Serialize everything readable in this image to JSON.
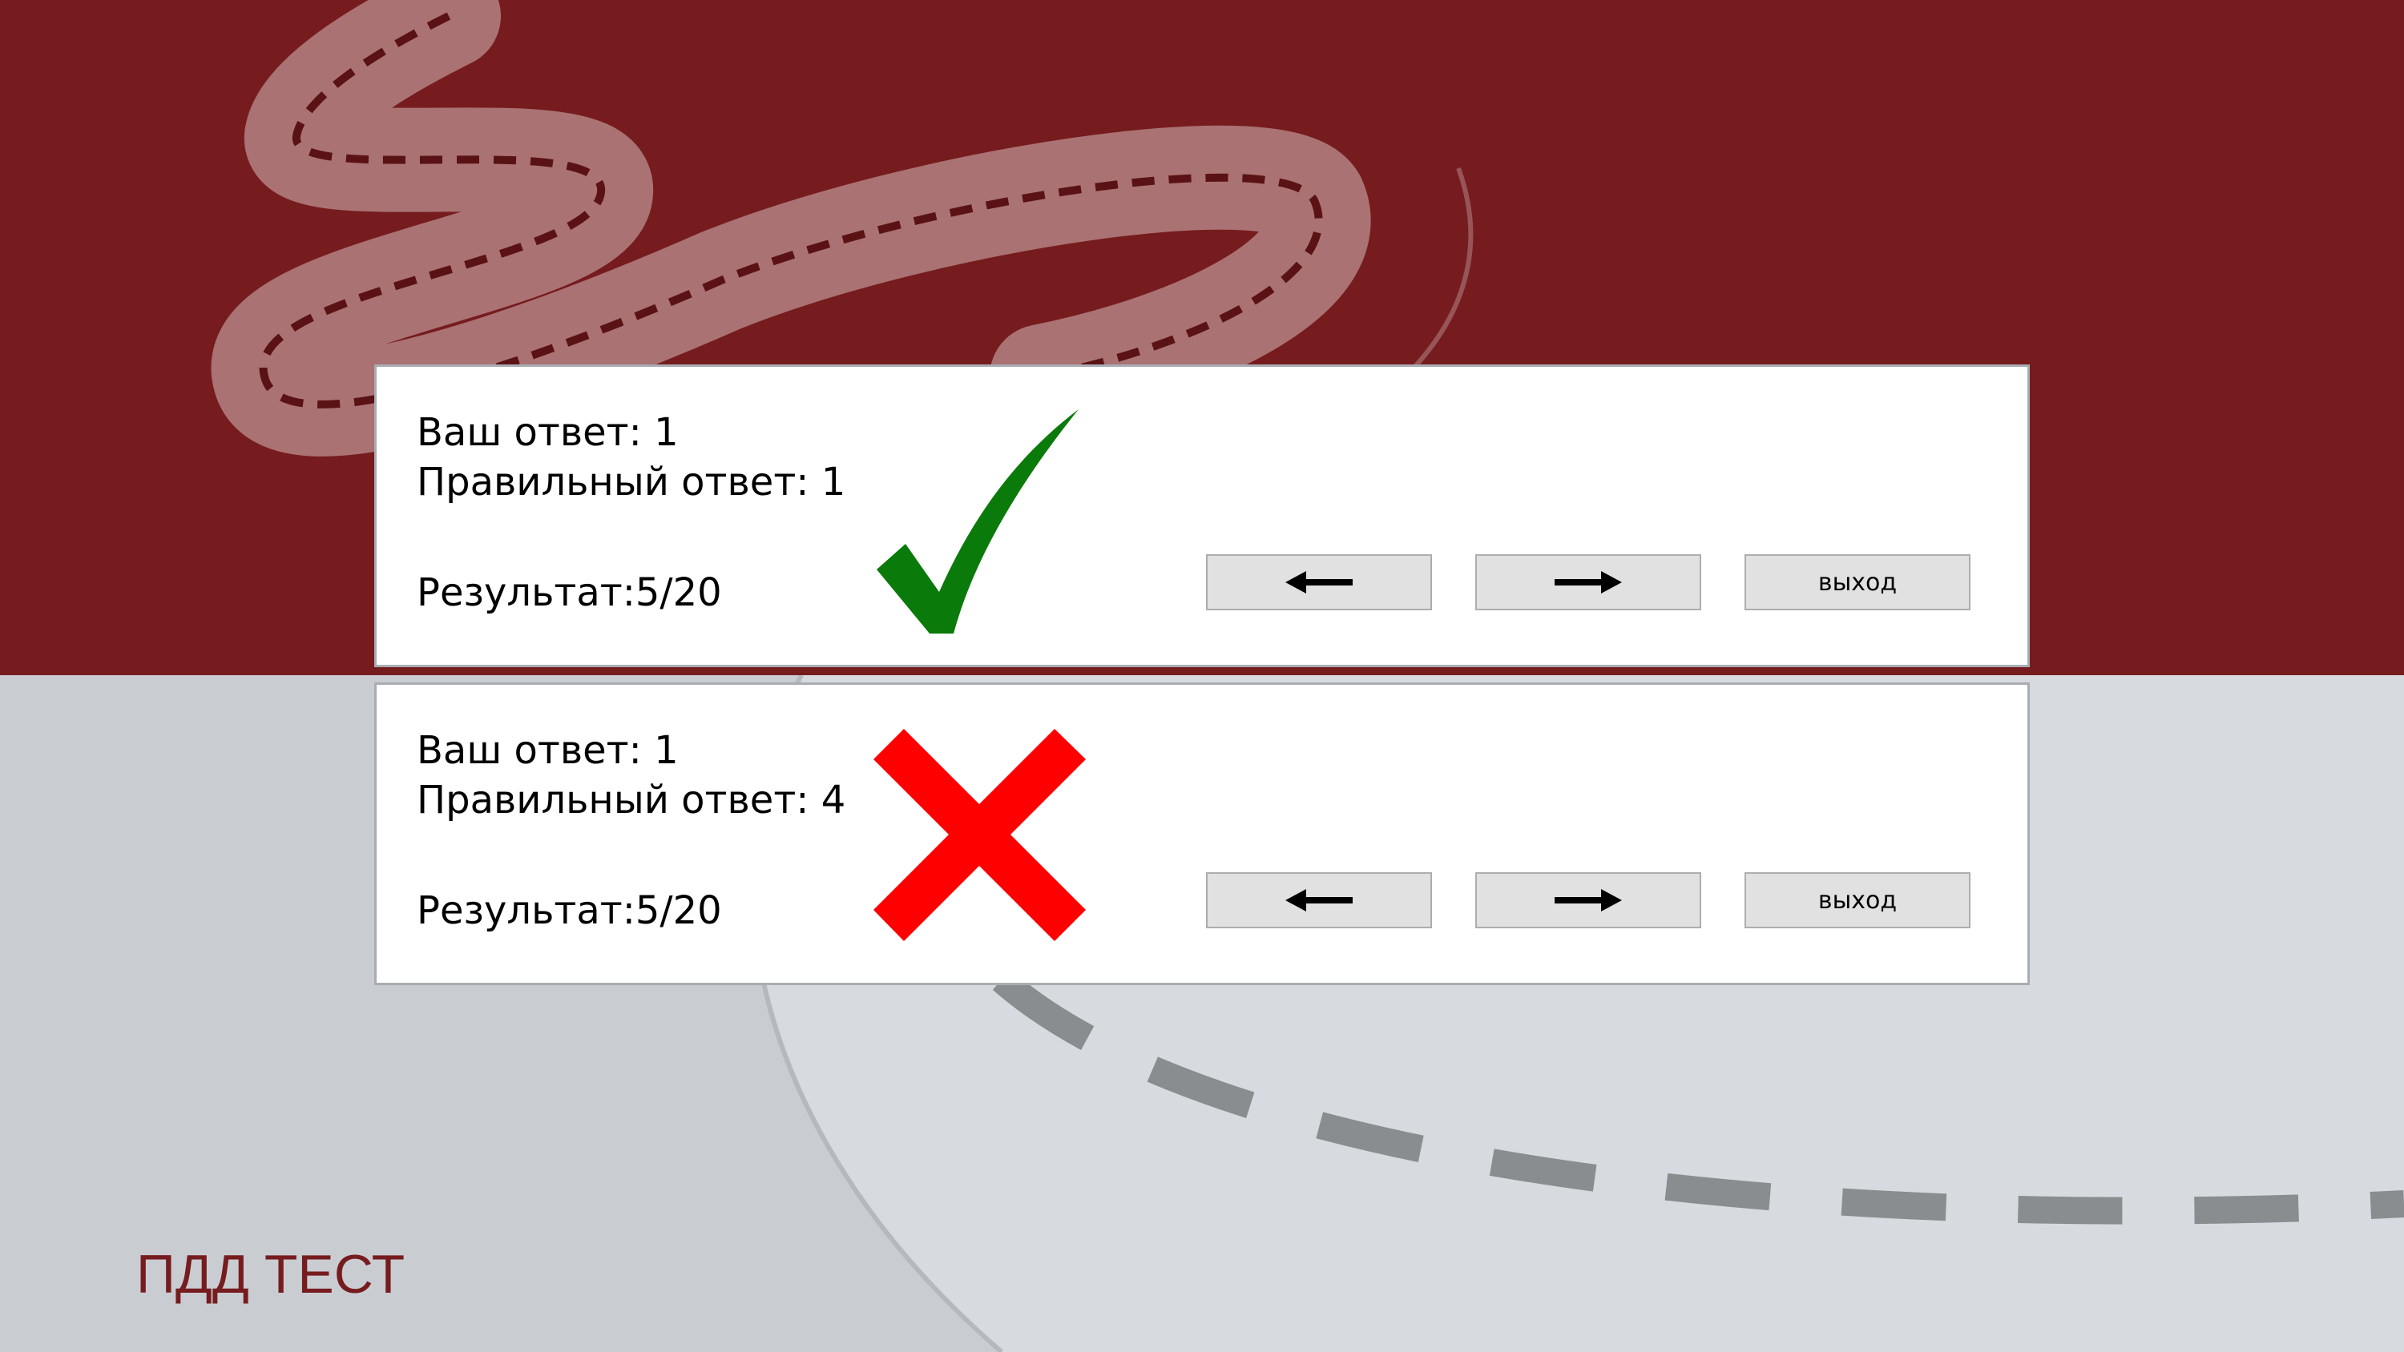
{
  "colors": {
    "brand_red": "#761c1e",
    "background_gray": "#c9cdd2",
    "check_green": "#0a7a0a",
    "cross_red": "#ff0000"
  },
  "panels": [
    {
      "your_answer": "Ваш ответ: 1",
      "correct_answer": "Правильный ответ: 1",
      "result": "Результат:5/20",
      "status_icon": "checkmark-icon",
      "prev_icon": "arrow-left-icon",
      "next_icon": "arrow-right-icon",
      "exit_label": "выход"
    },
    {
      "your_answer": "Ваш ответ: 1",
      "correct_answer": "Правильный ответ: 4",
      "result": "Результат:5/20",
      "status_icon": "cross-icon",
      "prev_icon": "arrow-left-icon",
      "next_icon": "arrow-right-icon",
      "exit_label": "выход"
    }
  ],
  "footer": {
    "title": "ПДД ТЕСТ"
  }
}
